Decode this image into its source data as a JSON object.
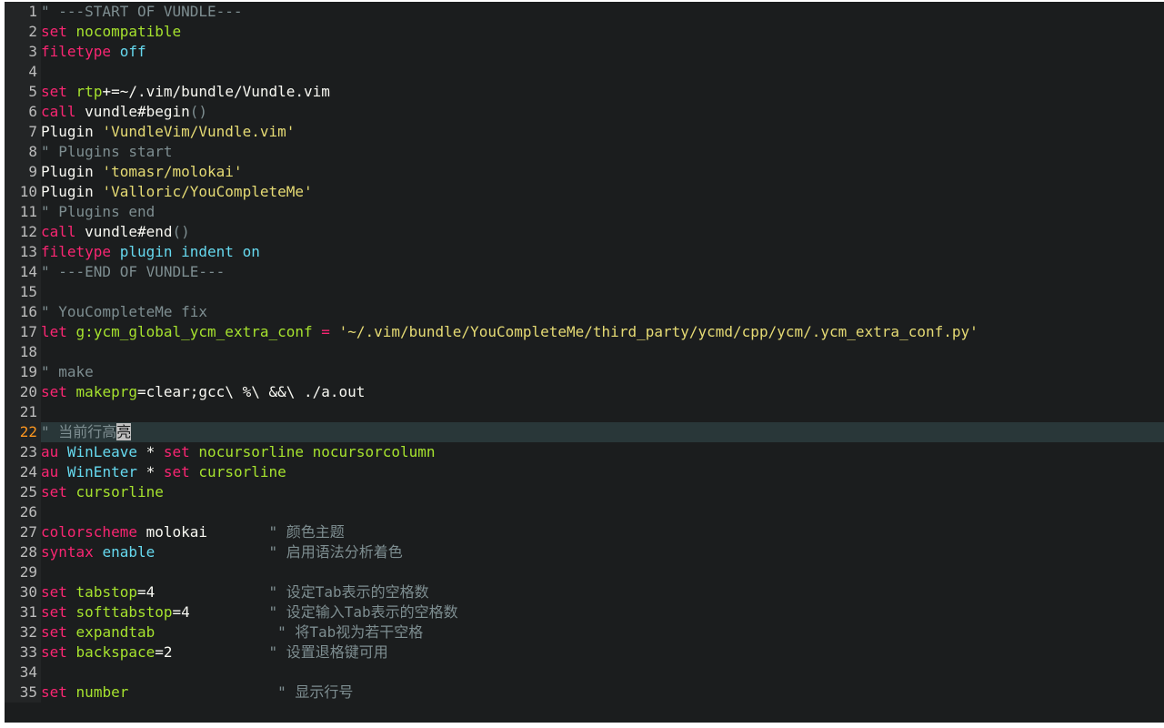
{
  "editor": {
    "current_line": 22,
    "colors": {
      "background": "#1b1d1e",
      "gutter": "#232526",
      "keyword": "#f92672",
      "option": "#a6e22e",
      "value": "#66d9ef",
      "comment": "#7e8e91",
      "string": "#e6db74",
      "text": "#f8f8f2"
    },
    "lines": [
      {
        "n": "1",
        "tokens": [
          {
            "c": "cm",
            "t": "\" ---START OF VUNDLE---"
          }
        ]
      },
      {
        "n": "2",
        "tokens": [
          {
            "c": "kw",
            "t": "set"
          },
          {
            "c": "pl",
            "t": " "
          },
          {
            "c": "opt",
            "t": "nocompatible"
          }
        ]
      },
      {
        "n": "3",
        "tokens": [
          {
            "c": "kw",
            "t": "filetype"
          },
          {
            "c": "pl",
            "t": " "
          },
          {
            "c": "val",
            "t": "off"
          }
        ]
      },
      {
        "n": "4",
        "tokens": []
      },
      {
        "n": "5",
        "tokens": [
          {
            "c": "kw",
            "t": "set"
          },
          {
            "c": "pl",
            "t": " "
          },
          {
            "c": "opt",
            "t": "rtp"
          },
          {
            "c": "pl",
            "t": "+=~/.vim/bundle/Vundle.vim"
          }
        ]
      },
      {
        "n": "6",
        "tokens": [
          {
            "c": "kw",
            "t": "call"
          },
          {
            "c": "pl",
            "t": " vundle#begin"
          },
          {
            "c": "cm",
            "t": "()"
          }
        ]
      },
      {
        "n": "7",
        "tokens": [
          {
            "c": "pl",
            "t": "Plugin "
          },
          {
            "c": "str",
            "t": "'VundleVim/Vundle.vim'"
          }
        ]
      },
      {
        "n": "8",
        "tokens": [
          {
            "c": "cm",
            "t": "\" Plugins start"
          }
        ]
      },
      {
        "n": "9",
        "tokens": [
          {
            "c": "pl",
            "t": "Plugin "
          },
          {
            "c": "str",
            "t": "'tomasr/molokai'"
          }
        ]
      },
      {
        "n": "10",
        "tokens": [
          {
            "c": "pl",
            "t": "Plugin "
          },
          {
            "c": "str",
            "t": "'Valloric/YouCompleteMe'"
          }
        ]
      },
      {
        "n": "11",
        "tokens": [
          {
            "c": "cm",
            "t": "\" Plugins end"
          }
        ]
      },
      {
        "n": "12",
        "tokens": [
          {
            "c": "kw",
            "t": "call"
          },
          {
            "c": "pl",
            "t": " vundle#end"
          },
          {
            "c": "cm",
            "t": "()"
          }
        ]
      },
      {
        "n": "13",
        "tokens": [
          {
            "c": "kw",
            "t": "filetype"
          },
          {
            "c": "pl",
            "t": " "
          },
          {
            "c": "val",
            "t": "plugin indent on"
          }
        ]
      },
      {
        "n": "14",
        "tokens": [
          {
            "c": "cm",
            "t": "\" ---END OF VUNDLE---"
          }
        ]
      },
      {
        "n": "15",
        "tokens": []
      },
      {
        "n": "16",
        "tokens": [
          {
            "c": "cm",
            "t": "\" YouCompleteMe fix"
          }
        ]
      },
      {
        "n": "17",
        "tokens": [
          {
            "c": "kw",
            "t": "let"
          },
          {
            "c": "pl",
            "t": " "
          },
          {
            "c": "opt",
            "t": "g:ycm_global_ycm_extra_conf"
          },
          {
            "c": "pl",
            "t": " "
          },
          {
            "c": "kw",
            "t": "="
          },
          {
            "c": "pl",
            "t": " "
          },
          {
            "c": "str",
            "t": "'~/.vim/bundle/YouCompleteMe/third_party/ycmd/cpp/ycm/.ycm_extra_conf.py'"
          }
        ]
      },
      {
        "n": "18",
        "tokens": []
      },
      {
        "n": "19",
        "tokens": [
          {
            "c": "cm",
            "t": "\" make"
          }
        ]
      },
      {
        "n": "20",
        "tokens": [
          {
            "c": "kw",
            "t": "set"
          },
          {
            "c": "pl",
            "t": " "
          },
          {
            "c": "opt",
            "t": "makeprg"
          },
          {
            "c": "pl",
            "t": "=clear;gcc\\ %\\ &&\\ ./a.out"
          }
        ]
      },
      {
        "n": "21",
        "tokens": []
      },
      {
        "n": "22",
        "tokens": [
          {
            "c": "cm",
            "t": "\" 当前行高"
          },
          {
            "c": "cursor",
            "t": "亮"
          }
        ]
      },
      {
        "n": "23",
        "tokens": [
          {
            "c": "kw",
            "t": "au"
          },
          {
            "c": "pl",
            "t": " "
          },
          {
            "c": "val",
            "t": "WinLeave"
          },
          {
            "c": "pl",
            "t": " * "
          },
          {
            "c": "kw",
            "t": "set"
          },
          {
            "c": "pl",
            "t": " "
          },
          {
            "c": "opt",
            "t": "nocursorline nocursorcolumn"
          }
        ]
      },
      {
        "n": "24",
        "tokens": [
          {
            "c": "kw",
            "t": "au"
          },
          {
            "c": "pl",
            "t": " "
          },
          {
            "c": "val",
            "t": "WinEnter"
          },
          {
            "c": "pl",
            "t": " * "
          },
          {
            "c": "kw",
            "t": "set"
          },
          {
            "c": "pl",
            "t": " "
          },
          {
            "c": "opt",
            "t": "cursorline"
          }
        ]
      },
      {
        "n": "25",
        "tokens": [
          {
            "c": "kw",
            "t": "set"
          },
          {
            "c": "pl",
            "t": " "
          },
          {
            "c": "opt",
            "t": "cursorline"
          }
        ]
      },
      {
        "n": "26",
        "tokens": []
      },
      {
        "n": "27",
        "tokens": [
          {
            "c": "kw",
            "t": "colorscheme"
          },
          {
            "c": "pl",
            "t": " molokai       "
          },
          {
            "c": "cm",
            "t": "\" 颜色主题"
          }
        ]
      },
      {
        "n": "28",
        "tokens": [
          {
            "c": "kw",
            "t": "syntax"
          },
          {
            "c": "pl",
            "t": " "
          },
          {
            "c": "val",
            "t": "enable"
          },
          {
            "c": "pl",
            "t": "             "
          },
          {
            "c": "cm",
            "t": "\" 启用语法分析着色"
          }
        ]
      },
      {
        "n": "29",
        "tokens": []
      },
      {
        "n": "30",
        "tokens": [
          {
            "c": "kw",
            "t": "set"
          },
          {
            "c": "pl",
            "t": " "
          },
          {
            "c": "opt",
            "t": "tabstop"
          },
          {
            "c": "pl",
            "t": "=4             "
          },
          {
            "c": "cm",
            "t": "\" 设定Tab表示的空格数"
          }
        ]
      },
      {
        "n": "31",
        "tokens": [
          {
            "c": "kw",
            "t": "set"
          },
          {
            "c": "pl",
            "t": " "
          },
          {
            "c": "opt",
            "t": "softtabstop"
          },
          {
            "c": "pl",
            "t": "=4         "
          },
          {
            "c": "cm",
            "t": "\" 设定输入Tab表示的空格数"
          }
        ]
      },
      {
        "n": "32",
        "tokens": [
          {
            "c": "kw",
            "t": "set"
          },
          {
            "c": "pl",
            "t": " "
          },
          {
            "c": "opt",
            "t": "expandtab"
          },
          {
            "c": "pl",
            "t": "              "
          },
          {
            "c": "cm",
            "t": "\" 将Tab视为若干空格"
          }
        ]
      },
      {
        "n": "33",
        "tokens": [
          {
            "c": "kw",
            "t": "set"
          },
          {
            "c": "pl",
            "t": " "
          },
          {
            "c": "opt",
            "t": "backspace"
          },
          {
            "c": "pl",
            "t": "=2           "
          },
          {
            "c": "cm",
            "t": "\" 设置退格键可用"
          }
        ]
      },
      {
        "n": "34",
        "tokens": []
      },
      {
        "n": "35",
        "tokens": [
          {
            "c": "kw",
            "t": "set"
          },
          {
            "c": "pl",
            "t": " "
          },
          {
            "c": "opt",
            "t": "number"
          },
          {
            "c": "pl",
            "t": "                 "
          },
          {
            "c": "cm",
            "t": "\" 显示行号"
          }
        ]
      }
    ]
  }
}
